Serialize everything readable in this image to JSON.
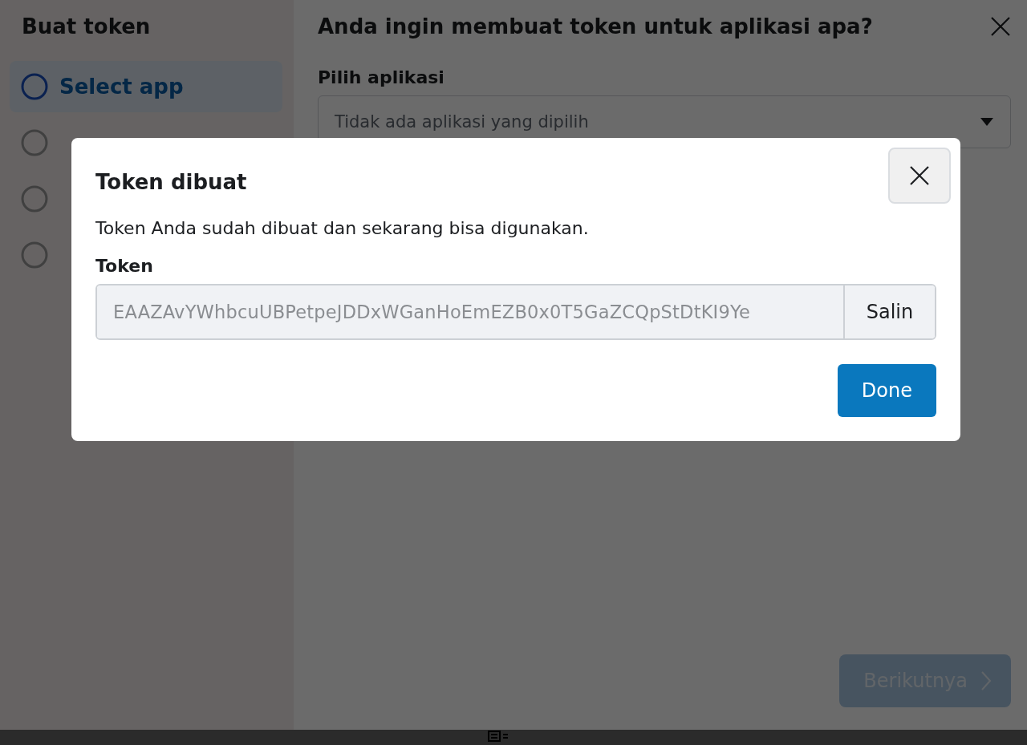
{
  "sidebar": {
    "title": "Buat token",
    "steps": [
      {
        "label": "Select app",
        "selected": true
      },
      {
        "selected": false
      },
      {
        "selected": false
      },
      {
        "selected": false
      }
    ]
  },
  "main": {
    "title": "Anda ingin membuat token untuk aplikasi apa?",
    "field_label": "Pilih aplikasi",
    "select": {
      "placeholder": "Tidak ada aplikasi yang dipilih"
    },
    "next_button": {
      "label": "Berikutnya",
      "disabled": true
    }
  },
  "modal": {
    "title": "Token dibuat",
    "message": "Token Anda sudah dibuat dan sekarang bisa digunakan.",
    "token_label": "Token",
    "token_value": "EAAZAvYWhbcuUBPetpeJDDxWGanHoEmEZB0x0T5GaZCQpStDtKI9Ye",
    "copy_button": "Salin",
    "done_button": "Done"
  }
}
